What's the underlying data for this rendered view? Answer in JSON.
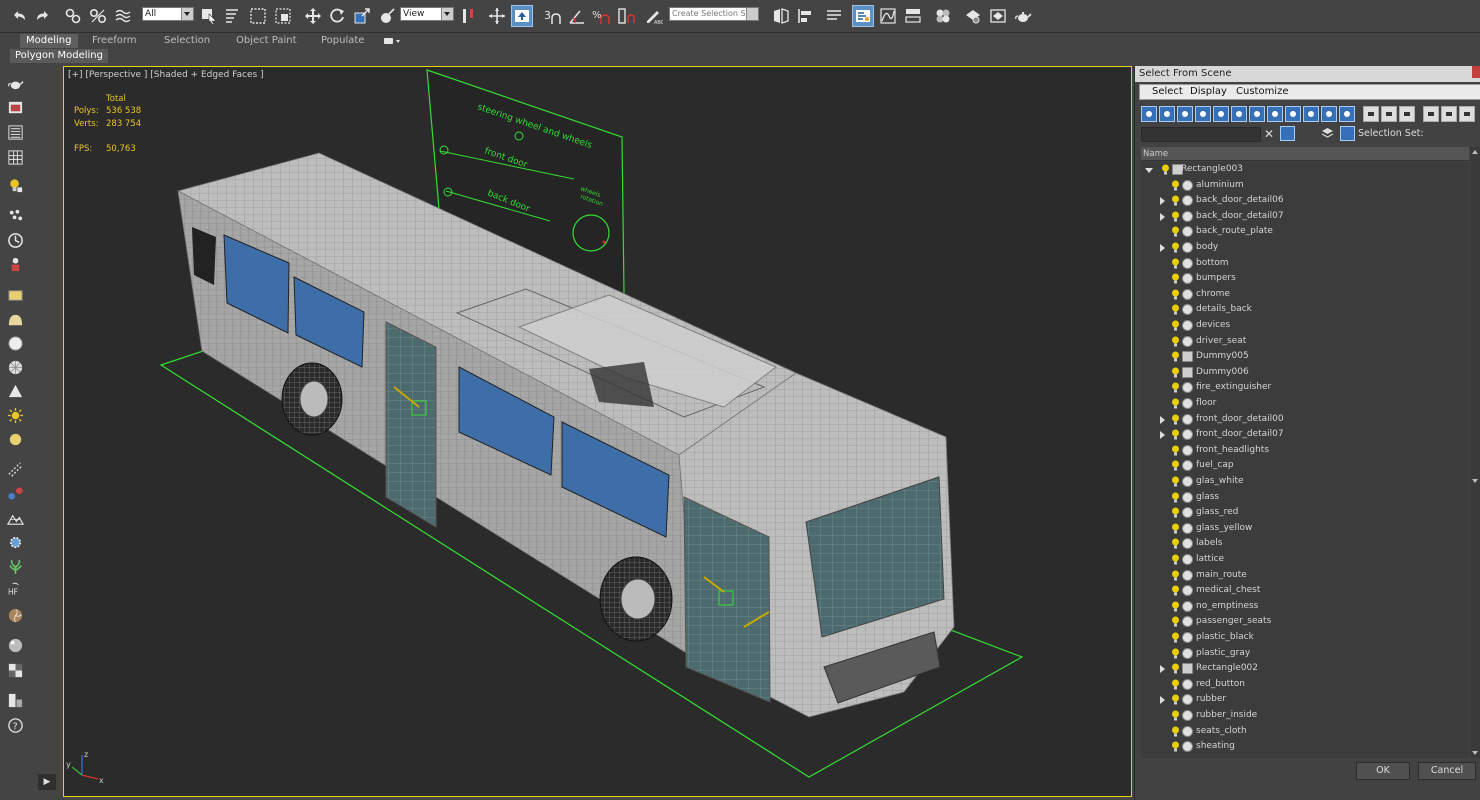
{
  "toolbar": {
    "selection_filter": "All",
    "ref_coord": "View",
    "named_selection_placeholder": "Create Selection Se"
  },
  "ribbon": {
    "tabs": [
      {
        "label": "Modeling"
      },
      {
        "label": "Freeform"
      },
      {
        "label": "Selection"
      },
      {
        "label": "Object Paint"
      },
      {
        "label": "Populate"
      }
    ],
    "sub_label": "Polygon Modeling"
  },
  "viewport": {
    "label": "[+] [Perspective ] [Shaded + Edged Faces ]",
    "stats": {
      "total_label": "Total",
      "polys_label": "Polys:",
      "polys_value": "536 538",
      "verts_label": "Verts:",
      "verts_value": "283 754",
      "fps_label": "FPS:",
      "fps_value": "50,763"
    },
    "control_panel": {
      "steering": "steering wheel and wheels",
      "front_door": "front door",
      "back_door": "back door",
      "wheels_rotation_1": "wheels",
      "wheels_rotation_2": "rotation"
    },
    "axis": {
      "x": "x",
      "y": "y",
      "z": "z"
    }
  },
  "dialog": {
    "title": "Select From Scene",
    "menus": [
      {
        "label": "Select"
      },
      {
        "label": "Display"
      },
      {
        "label": "Customize"
      }
    ],
    "selection_set_label": "Selection Set:",
    "column_name": "Name",
    "root": "Rectangle003",
    "items": [
      {
        "name": "aluminium",
        "expandable": false,
        "kind": "mesh"
      },
      {
        "name": "back_door_detail06",
        "expandable": true,
        "kind": "mesh"
      },
      {
        "name": "back_door_detail07",
        "expandable": true,
        "kind": "mesh"
      },
      {
        "name": "back_route_plate",
        "expandable": false,
        "kind": "mesh"
      },
      {
        "name": "body",
        "expandable": true,
        "kind": "mesh"
      },
      {
        "name": "bottom",
        "expandable": false,
        "kind": "mesh"
      },
      {
        "name": "bumpers",
        "expandable": false,
        "kind": "mesh"
      },
      {
        "name": "chrome",
        "expandable": false,
        "kind": "mesh"
      },
      {
        "name": "details_back",
        "expandable": false,
        "kind": "mesh"
      },
      {
        "name": "devices",
        "expandable": false,
        "kind": "mesh"
      },
      {
        "name": "driver_seat",
        "expandable": false,
        "kind": "mesh"
      },
      {
        "name": "Dummy005",
        "expandable": false,
        "kind": "dummy"
      },
      {
        "name": "Dummy006",
        "expandable": false,
        "kind": "dummy"
      },
      {
        "name": "fire_extinguisher",
        "expandable": false,
        "kind": "mesh"
      },
      {
        "name": "floor",
        "expandable": false,
        "kind": "mesh"
      },
      {
        "name": "front_door_detail00",
        "expandable": true,
        "kind": "mesh"
      },
      {
        "name": "front_door_detail07",
        "expandable": true,
        "kind": "mesh"
      },
      {
        "name": "front_headlights",
        "expandable": false,
        "kind": "mesh"
      },
      {
        "name": "fuel_cap",
        "expandable": false,
        "kind": "mesh"
      },
      {
        "name": "glas_white",
        "expandable": false,
        "kind": "mesh"
      },
      {
        "name": "glass",
        "expandable": false,
        "kind": "mesh"
      },
      {
        "name": "glass_red",
        "expandable": false,
        "kind": "mesh"
      },
      {
        "name": "glass_yellow",
        "expandable": false,
        "kind": "mesh"
      },
      {
        "name": "labels",
        "expandable": false,
        "kind": "mesh"
      },
      {
        "name": "lattice",
        "expandable": false,
        "kind": "mesh"
      },
      {
        "name": "main_route",
        "expandable": false,
        "kind": "mesh"
      },
      {
        "name": "medical_chest",
        "expandable": false,
        "kind": "mesh"
      },
      {
        "name": "no_emptiness",
        "expandable": false,
        "kind": "mesh"
      },
      {
        "name": "passenger_seats",
        "expandable": false,
        "kind": "mesh"
      },
      {
        "name": "plastic_black",
        "expandable": false,
        "kind": "mesh"
      },
      {
        "name": "plastic_gray",
        "expandable": false,
        "kind": "mesh"
      },
      {
        "name": "Rectangle002",
        "expandable": true,
        "kind": "dummy"
      },
      {
        "name": "red_button",
        "expandable": false,
        "kind": "mesh"
      },
      {
        "name": "rubber",
        "expandable": true,
        "kind": "mesh"
      },
      {
        "name": "rubber_inside",
        "expandable": false,
        "kind": "mesh"
      },
      {
        "name": "seats_cloth",
        "expandable": false,
        "kind": "mesh"
      },
      {
        "name": "sheating",
        "expandable": false,
        "kind": "mesh"
      }
    ],
    "ok_label": "OK",
    "cancel_label": "Cancel"
  },
  "colors": {
    "viewport_border": "#e8d200",
    "stats_text": "#e8c628",
    "helper_green": "#33dd33",
    "accent_blue": "#3570b8"
  }
}
